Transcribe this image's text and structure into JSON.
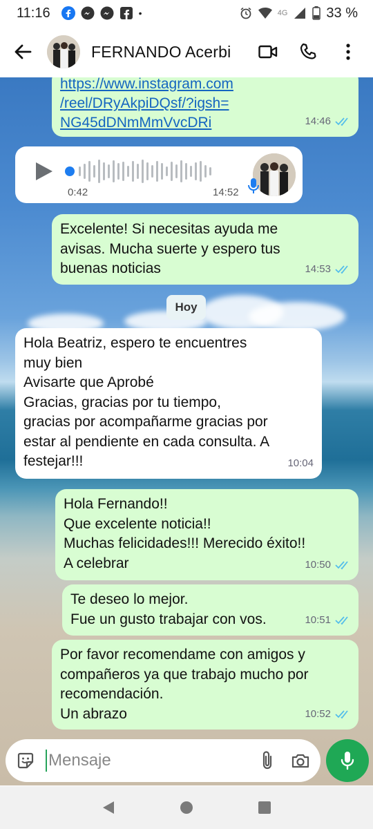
{
  "status_bar": {
    "time": "11:16",
    "dot": "•",
    "network": "4G",
    "battery": "33 %"
  },
  "header": {
    "contact_name": "FERNANDO Acerbi"
  },
  "messages": {
    "m1": {
      "link_lines": [
        "https://www.instagram.com",
        "/reel/DRyAkpiDQsf/?igsh=",
        "NG45dDNmMmVvcDRi"
      ],
      "time": "14:46"
    },
    "audio": {
      "duration": "0:42",
      "time": "14:52"
    },
    "m2": {
      "lines": [
        "Excelente! Si necesitas ayuda me",
        "avisas. Mucha suerte y espero tus",
        "buenas noticias"
      ],
      "time": "14:53"
    },
    "day_chip": "Hoy",
    "m3": {
      "lines": [
        "Hola Beatriz, espero te encuentres",
        "muy bien",
        "Avisarte que Aprobé",
        "Gracias,  gracias  por tu tiempo,",
        "gracias por acompañarme gracias por",
        "estar al pendiente en cada consulta.  A",
        "festejar!!!"
      ],
      "time": "10:04"
    },
    "m4": {
      "lines": [
        "Hola Fernando!!",
        "Que excelente noticia!!",
        "Muchas felicidades!!! Merecido éxito!!",
        "A celebrar"
      ],
      "time": "10:50"
    },
    "m5": {
      "lines": [
        "Te deseo lo mejor.",
        "Fue un gusto trabajar con vos."
      ],
      "time": "10:51"
    },
    "m6": {
      "lines": [
        "Por favor recomendame con amigos y",
        "compañeros ya que trabajo mucho por",
        "recomendación.",
        "Un abrazo"
      ],
      "time": "10:52"
    }
  },
  "composer": {
    "placeholder": "Mensaje"
  },
  "colors": {
    "outgoing_bubble": "#d8fdd2",
    "incoming_bubble": "#ffffff",
    "accent_green": "#1fa855",
    "tick_blue": "#53bdeb"
  }
}
